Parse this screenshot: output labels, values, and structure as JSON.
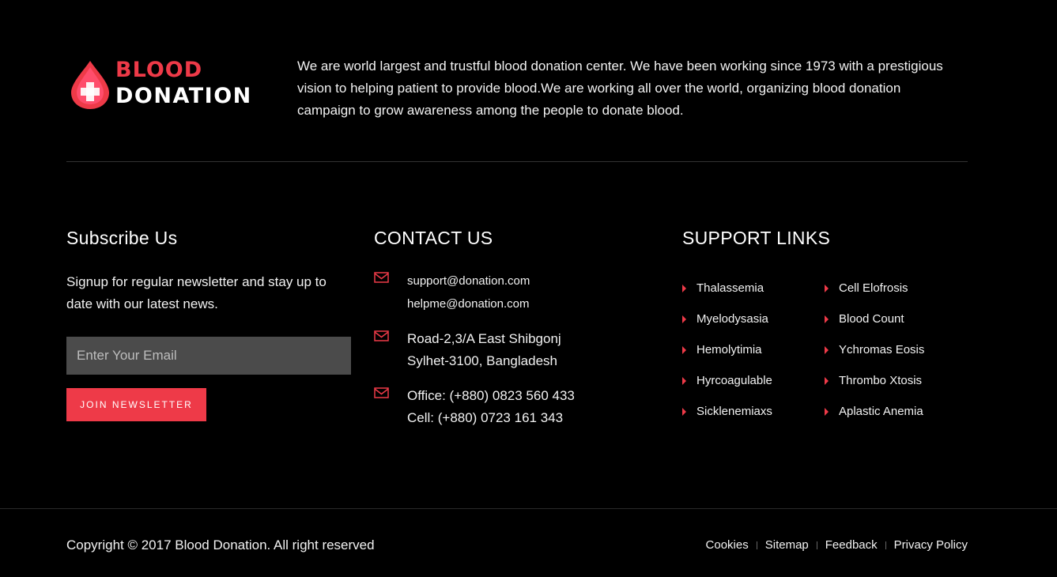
{
  "colors": {
    "accent": "#ee3a48",
    "background": "#000000",
    "input_bg": "#4b4b4b"
  },
  "brand": {
    "word1": "BLOOD",
    "word2": "DONATION",
    "icon": "blood-drop-cross-icon"
  },
  "about": "We are world largest and trustful blood donation center. We have been working since 1973 with a prestigious vision to helping patient to provide blood.We are working all over the world, organizing blood donation campaign to grow awareness among the people to donate blood.",
  "subscribe": {
    "title": "Subscribe Us",
    "text": "Signup for regular newsletter and stay up to date with our latest news.",
    "placeholder": "Enter Your Email",
    "button_label": "Join Newsletter"
  },
  "contact": {
    "title": "CONTACT US",
    "emails": [
      "support@donation.com",
      "helpme@donation.com"
    ],
    "address": [
      "Road-2,3/A East Shibgonj",
      "Sylhet-3100, Bangladesh"
    ],
    "phones": [
      "Office:  (+880) 0823 560 433",
      "Cell:  (+880) 0723 161 343"
    ],
    "icon": "envelope-icon"
  },
  "support": {
    "title": "SUPPORT LINKS",
    "links": [
      "Thalassemia",
      "Cell Elofrosis",
      "Myelodysasia",
      "Blood Count",
      "Hemolytimia",
      "Ychromas Eosis",
      "Hyrcoagulable",
      "Thrombo Xtosis",
      "Sicklenemiaxs",
      "Aplastic Anemia"
    ]
  },
  "footer": {
    "copyright": "Copyright © 2017 Blood Donation. All right reserved",
    "nav": [
      "Cookies",
      "Sitemap",
      "Feedback",
      "Privacy Policy"
    ]
  }
}
